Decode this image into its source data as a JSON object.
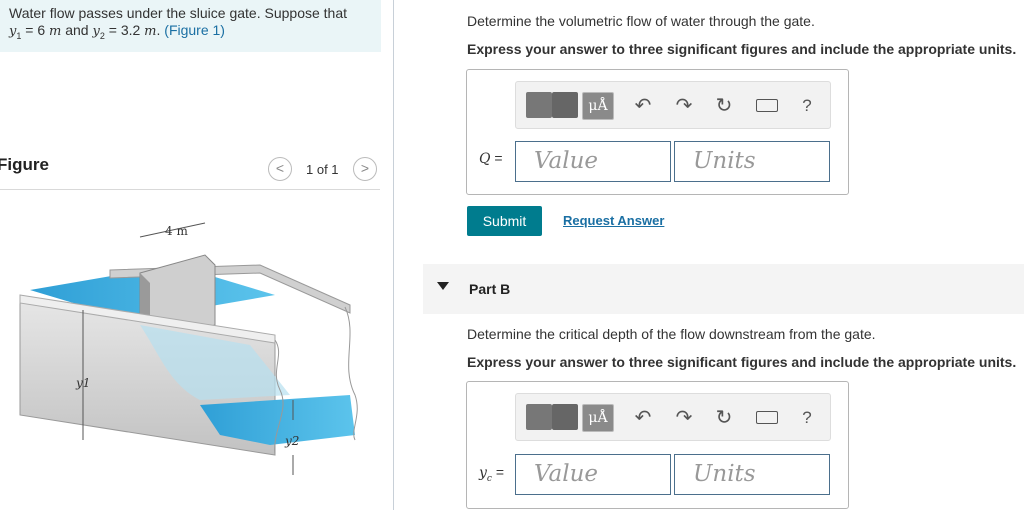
{
  "problem": {
    "line1": "Water flow passes under the sluice gate. Suppose that",
    "y1_sym": "y",
    "y1_sub": "1",
    "y1_eq": " = 6 ",
    "y1_unit": "m",
    "and": " and ",
    "y2_sym": "y",
    "y2_sub": "2",
    "y2_eq": " = 3.2 ",
    "y2_unit": "m",
    "period": ". ",
    "figure_link": "(Figure 1)"
  },
  "figure": {
    "title": "Figure",
    "prev_icon": "chevron-left-icon",
    "next_icon": "chevron-right-icon",
    "prev_glyph": "<",
    "next_glyph": ">",
    "count": "1 of 1",
    "labels": {
      "width": "4 m",
      "y1": "y1",
      "y2": "y2"
    }
  },
  "part_a": {
    "question": "Determine the volumetric flow of water through the gate.",
    "instruction": "Express your answer to three significant figures and include the appropriate units.",
    "var_label": "Q",
    "eq": " =",
    "value_placeholder": "Value",
    "units_placeholder": "Units",
    "submit": "Submit",
    "request_answer": "Request Answer"
  },
  "part_b": {
    "title": "Part B",
    "question": "Determine the critical depth of the flow downstream from the gate.",
    "instruction": "Express your answer to three significant figures and include the appropriate units.",
    "var_label": "y",
    "var_sub": "c",
    "eq": " =",
    "value_placeholder": "Value",
    "units_placeholder": "Units"
  },
  "toolbar": {
    "units_label": "μÅ",
    "undo_icon": "undo-icon",
    "redo_icon": "redo-icon",
    "reset_icon": "reset-icon",
    "keyboard_icon": "keyboard-icon",
    "help_label": "?"
  },
  "colors": {
    "accent": "#007c8e",
    "link": "#1a6fa3",
    "water": "#3aaad8"
  }
}
